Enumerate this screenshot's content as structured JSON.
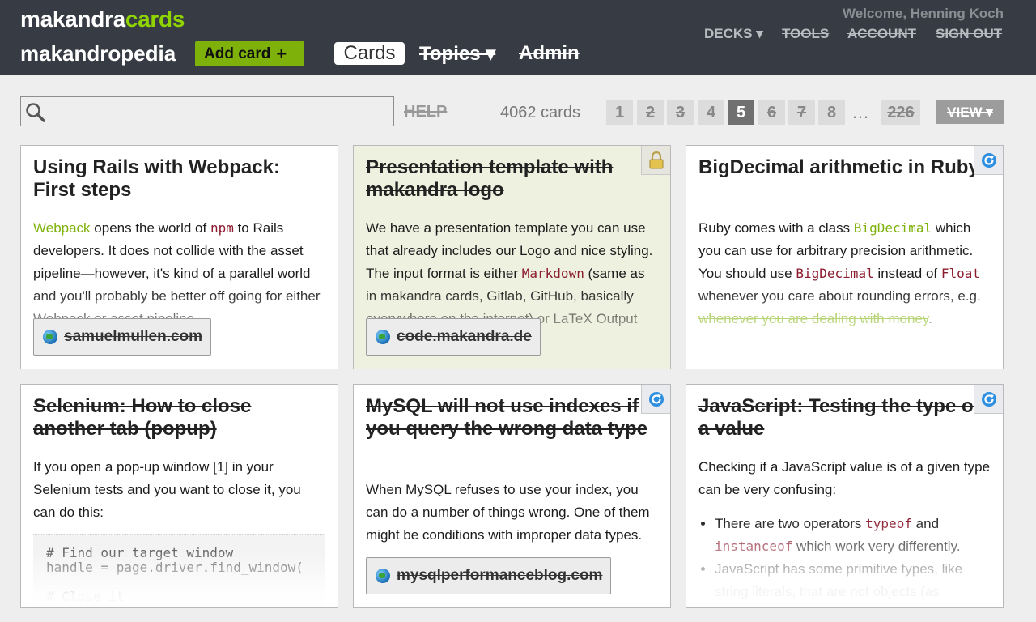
{
  "header": {
    "logo_main": "makandra",
    "logo_accent": "cards",
    "site_name": "makandropedia",
    "add_card_label": "Add card",
    "nav_cards": "Cards",
    "nav_topics": "Topics ▾",
    "nav_admin": "Admin",
    "welcome": "Welcome, Henning Koch",
    "decks": "DECKS ▾",
    "tools": "TOOLS",
    "account": "ACCOUNT",
    "sign_out": "SIGN OUT"
  },
  "toolbar": {
    "search_value": "",
    "help_label": "HELP",
    "count_label": "4062 cards",
    "pages": [
      "1",
      "2",
      "3",
      "4",
      "5",
      "6",
      "7",
      "8"
    ],
    "current_page": "5",
    "ellipsis": "…",
    "last_page": "226",
    "view_label": "VIEW ▾"
  },
  "cards": [
    {
      "title": "Using Rails with Webpack: First steps",
      "body": {
        "p1a": "Webpack",
        "p1b": " opens the world of ",
        "p1c": "npm",
        "p1d": " to Rails developers. It does not collide with the asset pipeline—however, it's kind of a parallel world and you'll probably be better off going for either Webpack or asset pipeline."
      },
      "source": "samuelmullen.com"
    },
    {
      "title": "Presentation template with makandra logo",
      "body": {
        "p1a": "We have a presentation template you can use that already includes our Logo and nice styling. The input format is either ",
        "p1b": "Markdown",
        "p1c": " (same as in makandra cards, Gitlab, GitHub, basically everywhere on the internet) or LaTeX ",
        "p1d": "Output format is"
      },
      "source": "code.makandra.de",
      "icon": "lock-icon"
    },
    {
      "title": "BigDecimal arithmetic in Ruby",
      "body": {
        "p1a": "Ruby comes with a class ",
        "p1b": "BigDecimal",
        "p1c": " which you can use for arbitrary precision arithmetic. You should use ",
        "p1d": "BigDecimal",
        "p1e": " instead of ",
        "p1f": "Float",
        "p1g": " whenever you care about rounding errors, e.g. ",
        "p1h": "whenever you are dealing with money",
        "p1i": "."
      },
      "icon": "refresh-icon"
    },
    {
      "title": "Selenium: How to close another tab (popup)",
      "body": {
        "p1": "If you open a pop-up window [1] in your Selenium tests and you want to close it, you can do this:"
      },
      "code": "# Find our target window\nhandle = page.driver.find_window(\n\n# Close it"
    },
    {
      "title": "MySQL will not use indexes if you query the wrong data type",
      "body": {
        "p1": "When MySQL refuses to use your index, you can do a number of things wrong. One of them might be conditions with improper data types."
      },
      "source": "mysqlperformanceblog.com",
      "icon": "refresh-icon"
    },
    {
      "title": "JavaScript: Testing the type of a value",
      "body": {
        "p1": "Checking if a JavaScript value is of a given type can be very confusing:",
        "li1a": "There are two operators ",
        "li1b": "typeof",
        "li1c": " and ",
        "li1d": "instanceof",
        "li1e": " which work very differently.",
        "li2": "JavaScript has some primitive types, like string literals, that are not objects (as"
      },
      "icon": "refresh-icon"
    }
  ],
  "colors": {
    "header_bg": "#373b43",
    "accent_green": "#7eb20a",
    "logo_green": "#8fd400",
    "active_page": "#707070"
  }
}
